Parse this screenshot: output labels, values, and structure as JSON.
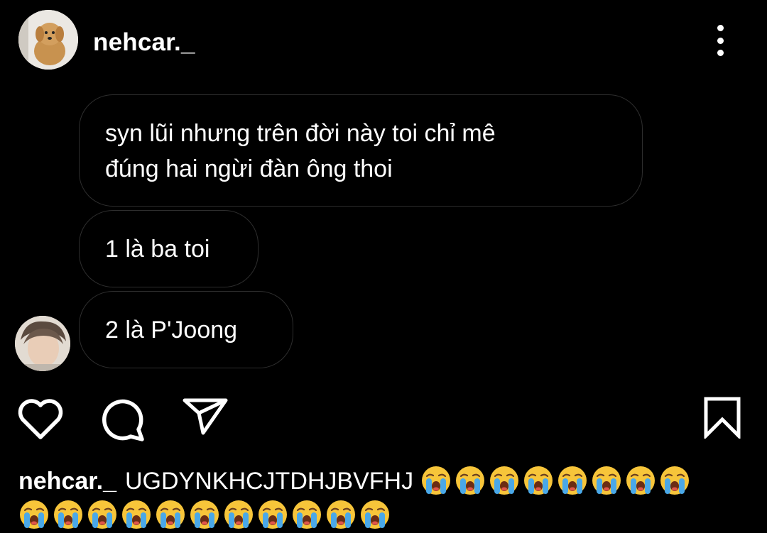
{
  "header": {
    "username": "nehcar._",
    "more_icon": "more-vertical-icon"
  },
  "messages": [
    {
      "text_line1": "syn lũi nhưng trên đời này toi chỉ mê",
      "text_line2": "đúng hai ngừi đàn ông thoi"
    },
    {
      "text": "1 là ba toi"
    },
    {
      "text": "2 là P'Joong"
    }
  ],
  "actions": {
    "like_icon": "heart-icon",
    "comment_icon": "comment-icon",
    "share_icon": "paper-plane-icon",
    "save_icon": "bookmark-icon"
  },
  "caption": {
    "username": "nehcar._",
    "text": "UGDYNKHCJTDHJBVFHJ",
    "emoji_line1_count": 8,
    "emoji_line2_count": 11,
    "emoji_name": "loudly-crying-face"
  },
  "colors": {
    "background": "#000000",
    "bubble_border": "#2e2e2e",
    "text": "#ffffff"
  }
}
